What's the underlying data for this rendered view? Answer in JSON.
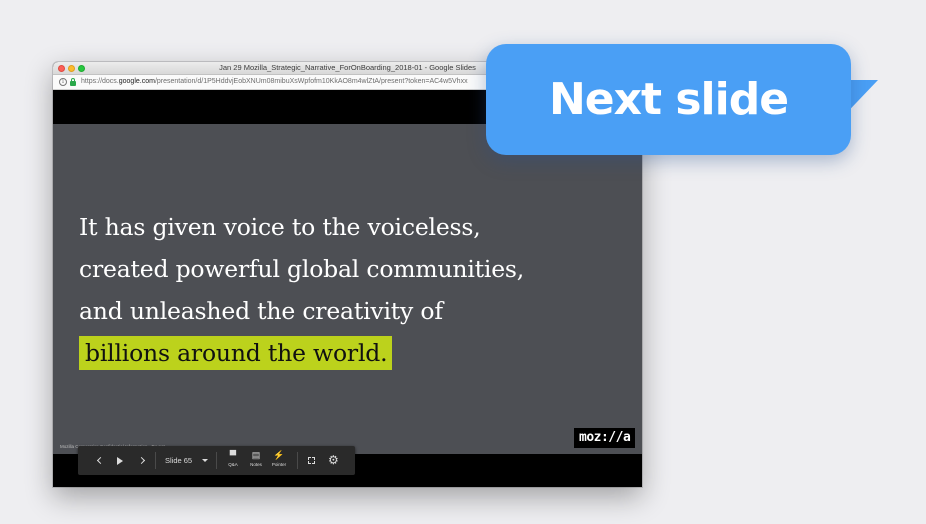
{
  "window": {
    "title": "Jan 29 Mozilla_Strategic_Narrative_ForOnBoarding_2018-01 - Google Slides",
    "url_prefix": "https://docs.",
    "url_domain": "google.com",
    "url_rest": "/presentation/d/1P5HddvjEobXNUm08mibuXsWpfofm10KkAO8m4wlZtA/present?token=AC4w5Vhxx"
  },
  "slide": {
    "lines": [
      "It has given voice to the voiceless,",
      "created powerful global communities,",
      "and unleashed the creativity of"
    ],
    "highlight_line": "billions around the world.",
    "footer_note": "Mozilla Corporation Confidential Information · Do not ...",
    "logo": "moz://a"
  },
  "controls": {
    "slide_label": "Slide 65",
    "qa_label": "Q&A",
    "notes_label": "Notes",
    "pointer_label": "Pointer"
  },
  "bubble": {
    "text": "Next slide"
  },
  "colors": {
    "bubble": "#4a9ff5",
    "slide_bg": "#4d4f54",
    "highlight": "#bcd21c"
  }
}
